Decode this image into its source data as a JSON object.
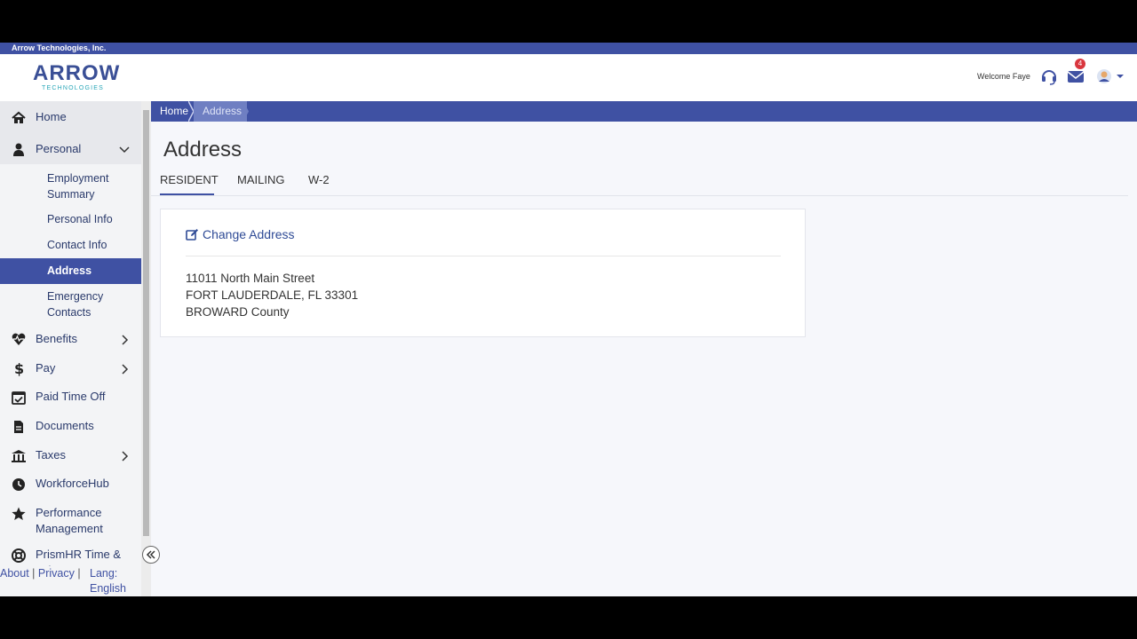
{
  "company_bar": {
    "name": "Arrow Technologies, Inc."
  },
  "header": {
    "logo_main": "ARROW",
    "logo_sub": "TECHNOLOGIES",
    "welcome": "Welcome Faye",
    "icons": [
      "headset-icon",
      "mail-icon",
      "avatar"
    ],
    "mail_badge": "4"
  },
  "sidebar": {
    "items": [
      {
        "label": "Home",
        "icon": "home-icon"
      },
      {
        "label": "Personal",
        "icon": "user-icon"
      },
      {
        "label": "Benefits",
        "icon": "heart-pulse-icon"
      },
      {
        "label": "Pay",
        "icon": "dollar-icon"
      },
      {
        "label": "Paid Time Off",
        "icon": "calendar-check-icon"
      },
      {
        "label": "Documents",
        "icon": "document-icon"
      },
      {
        "label": "Taxes",
        "icon": "bank-icon"
      },
      {
        "label": "WorkforceHub",
        "icon": "clock-icon"
      },
      {
        "label": "Performance Management",
        "icon": "star-icon"
      },
      {
        "label": "PrismHR Time & Labor",
        "icon": "lifebuoy-icon"
      }
    ],
    "personal_sub": [
      {
        "label": "Employment Summary"
      },
      {
        "label": "Personal Info"
      },
      {
        "label": "Contact Info"
      },
      {
        "label": "Address"
      },
      {
        "label": "Emergency Contacts"
      }
    ]
  },
  "footer": {
    "about": "About",
    "sep": "|",
    "privacy": "Privacy",
    "lang": "Lang: English"
  },
  "breadcrumb": {
    "home": "Home",
    "current": "Address"
  },
  "page": {
    "title": "Address"
  },
  "tabs": [
    {
      "label": "RESIDENT",
      "active": true
    },
    {
      "label": "MAILING",
      "active": false
    },
    {
      "label": "W-2",
      "active": false
    }
  ],
  "card": {
    "change_label": "Change Address",
    "address": {
      "line1": "11011 North Main Street",
      "line2": "FORT LAUDERDALE, FL 33301",
      "line3": "BROWARD County"
    }
  },
  "colors": {
    "primary": "#3f51a3",
    "link": "#2f4b96",
    "badge": "#d9363e"
  }
}
